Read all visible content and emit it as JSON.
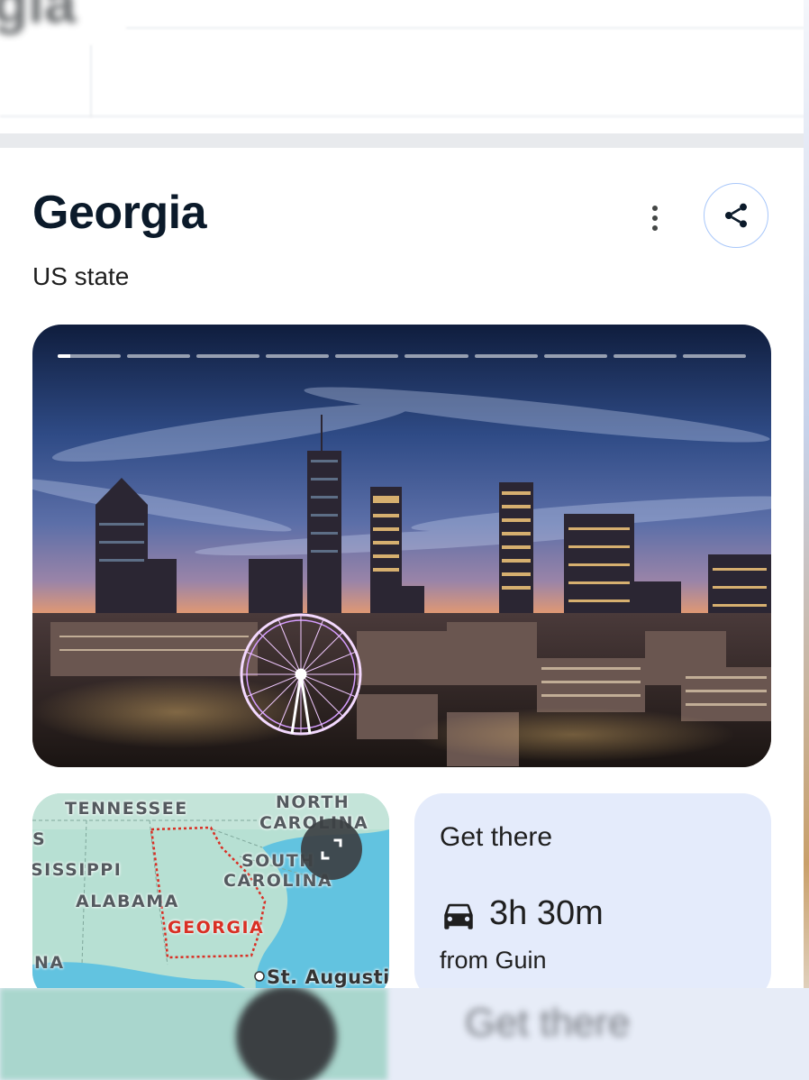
{
  "header_ghost": {
    "title_fragment": "gia"
  },
  "entity": {
    "title": "Georgia",
    "subtitle": "US state"
  },
  "actions": {
    "more_icon": "more-vert-icon",
    "share_icon": "share-icon"
  },
  "hero": {
    "image": "Atlanta skyline at dusk with Ferris wheel",
    "slide_count": 10,
    "active_slide": 1,
    "active_progress": 0.2
  },
  "map": {
    "labels": {
      "tennessee": "TENNESSEE",
      "north_carolina_1": "NORTH",
      "north_carolina_2": "CAROLINA",
      "south_carolina_1": "SOUTH",
      "south_carolina_2": "CAROLINA",
      "mississippi": "SISSIPPI",
      "alabama": "ALABAMA",
      "georgia": "GEORGIA",
      "left_s": "S",
      "left_na": "NA",
      "st_augustine": "St. Augusti"
    },
    "expand_icon": "expand-icon",
    "highlight_color": "#d93025"
  },
  "directions": {
    "title": "Get there",
    "mode_icon": "car-icon",
    "duration": "3h 30m",
    "origin": "from Guin"
  },
  "bottom_ghost": {
    "text": "Get there"
  },
  "colors": {
    "title": "#0b1a2a",
    "share_border": "#a8c7fa",
    "directions_bg": "#e4ebfb",
    "map_water": "#62c3e0",
    "map_land": "#b7e0d3"
  }
}
